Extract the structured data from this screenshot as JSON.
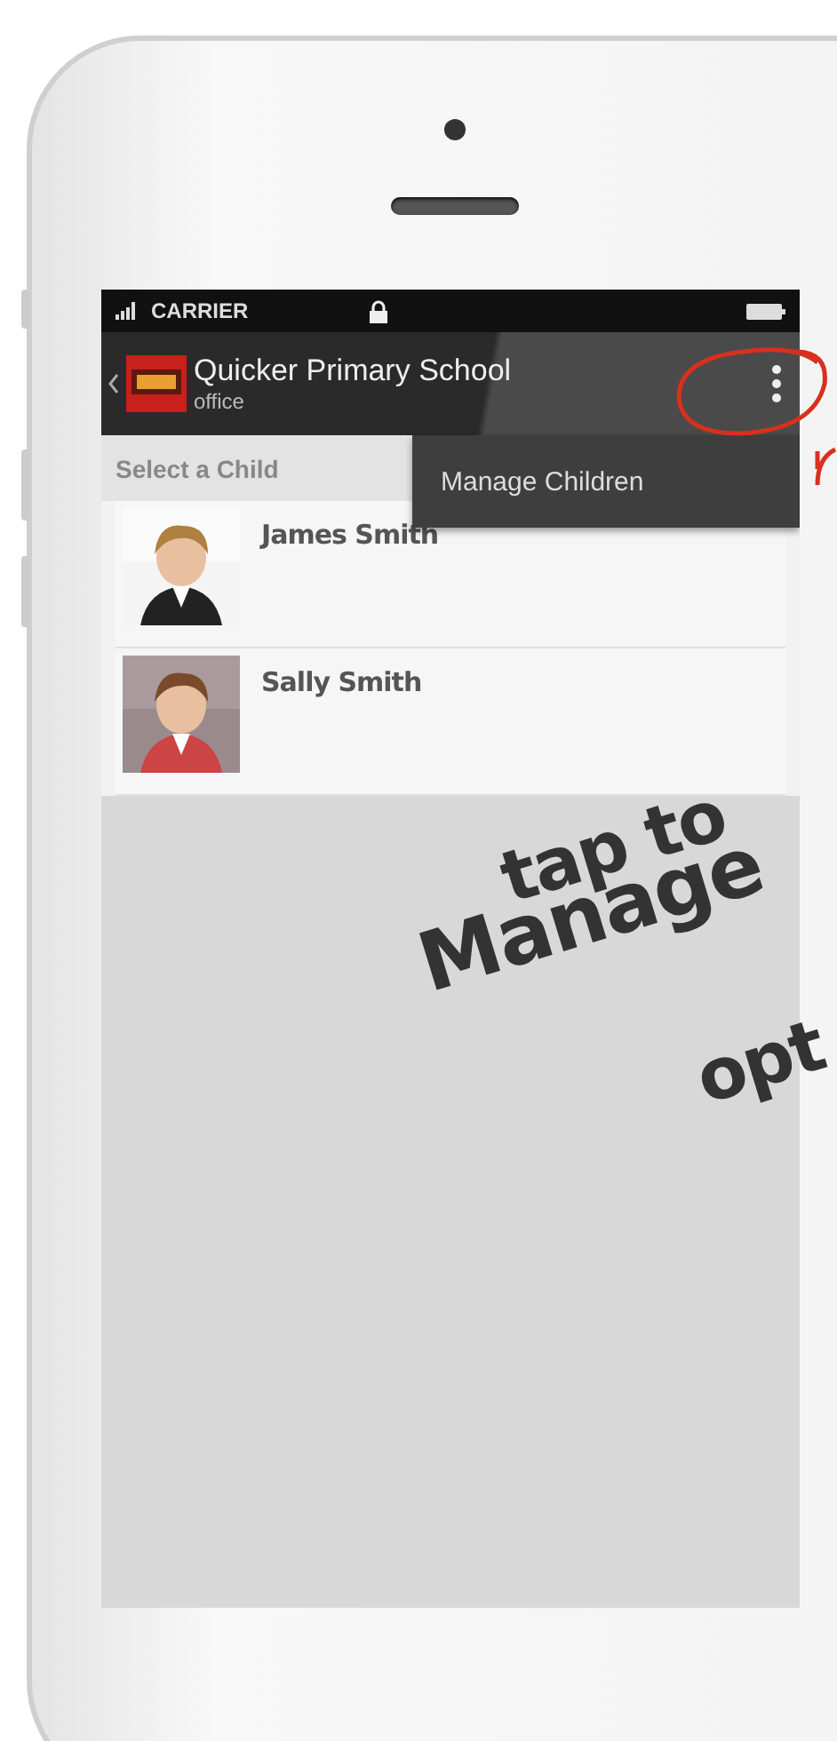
{
  "status_bar": {
    "carrier": "CARRIER"
  },
  "action_bar": {
    "title": "Quicker Primary School",
    "subtitle": "office"
  },
  "section_header": "Select a Child",
  "children": [
    {
      "name": "James Smith"
    },
    {
      "name": "Sally Smith"
    }
  ],
  "overflow_menu": {
    "items": [
      "Manage Children"
    ]
  },
  "annotation": {
    "lines": [
      "tap to",
      "Manage",
      "opt"
    ]
  }
}
